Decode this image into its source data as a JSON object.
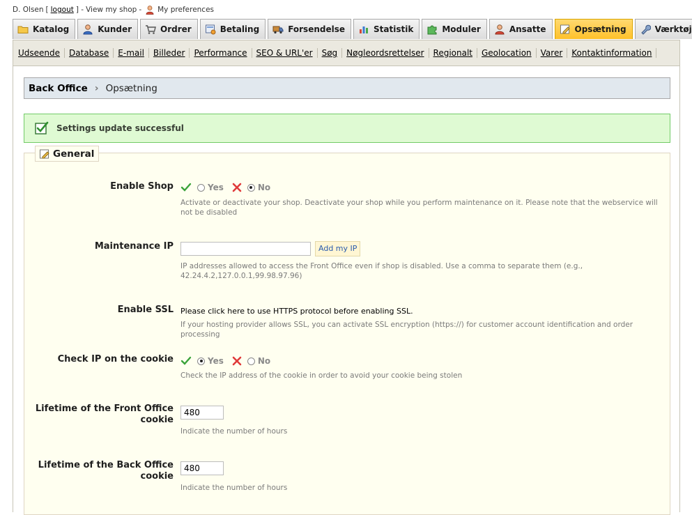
{
  "topbar": {
    "user": "D. Olsen",
    "logout": "logout",
    "view_shop": "View my shop",
    "preferences": "My preferences"
  },
  "tabs": [
    {
      "label": "Katalog",
      "icon": "folder-icon"
    },
    {
      "label": "Kunder",
      "icon": "customer-icon"
    },
    {
      "label": "Ordrer",
      "icon": "cart-icon"
    },
    {
      "label": "Betaling",
      "icon": "payment-icon"
    },
    {
      "label": "Forsendelse",
      "icon": "truck-icon"
    },
    {
      "label": "Statistik",
      "icon": "chart-icon"
    },
    {
      "label": "Moduler",
      "icon": "puzzle-icon"
    },
    {
      "label": "Ansatte",
      "icon": "employee-icon"
    },
    {
      "label": "Opsætning",
      "icon": "preferences-icon",
      "active": true
    },
    {
      "label": "Værktøjer",
      "icon": "wrench-icon"
    }
  ],
  "subnav": [
    "Udseende",
    "Database",
    "E-mail",
    "Billeder",
    "Performance",
    "SEO & URL'er",
    "Søg",
    "Nøgleordsrettelser",
    "Regionalt",
    "Geolocation",
    "Varer",
    "Kontaktinformation"
  ],
  "breadcrumb": {
    "root": "Back Office",
    "current": "Opsætning"
  },
  "alert": "Settings update successful",
  "fieldset": {
    "legend": "General"
  },
  "fields": {
    "enable_shop": {
      "label": "Enable Shop",
      "yes": "Yes",
      "no": "No",
      "selected": "no",
      "help": "Activate or deactivate your shop. Deactivate your shop while you perform maintenance on it. Please note that the webservice will not be disabled"
    },
    "maintenance_ip": {
      "label": "Maintenance IP",
      "value": "",
      "button": "Add my IP",
      "help": "IP addresses allowed to access the Front Office even if shop is disabled. Use a comma to separate them (e.g., 42.24.4.2,127.0.0.1,99.98.97.96)"
    },
    "enable_ssl": {
      "label": "Enable SSL",
      "link": "Please click here to use HTTPS protocol before enabling SSL.",
      "help": "If your hosting provider allows SSL, you can activate SSL encryption (https://) for customer account identification and order processing"
    },
    "check_ip_cookie": {
      "label": "Check IP on the cookie",
      "yes": "Yes",
      "no": "No",
      "selected": "yes",
      "help": "Check the IP address of the cookie in order to avoid your cookie being stolen"
    },
    "front_cookie": {
      "label": "Lifetime of the Front Office cookie",
      "value": "480",
      "help": "Indicate the number of hours"
    },
    "back_cookie": {
      "label": "Lifetime of the Back Office cookie",
      "value": "480",
      "help": "Indicate the number of hours"
    }
  },
  "colors": {
    "active_tab": "#ffc12a",
    "alert_bg": "#dffad3",
    "alert_border": "#72cb67",
    "breadcrumb_bg": "#e1e8ee",
    "fieldset_bg": "#fffff0"
  }
}
